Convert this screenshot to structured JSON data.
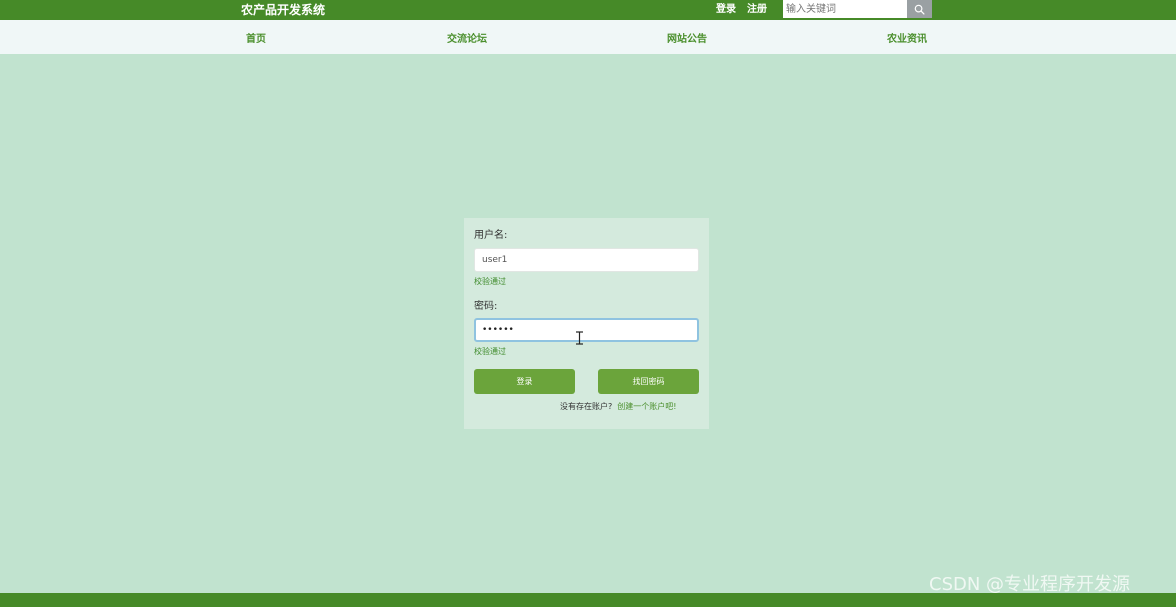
{
  "header": {
    "site_title": "农产品开发系统",
    "login_link": "登录",
    "register_link": "注册",
    "search_placeholder": "输入关键词",
    "search_icon": "magnifier-icon"
  },
  "nav": {
    "items": [
      {
        "label": "首页"
      },
      {
        "label": "交流论坛"
      },
      {
        "label": "网站公告"
      },
      {
        "label": "农业资讯"
      }
    ]
  },
  "login_form": {
    "username_label": "用户名:",
    "username_value": "user1",
    "username_validation": "校验通过",
    "password_label": "密码:",
    "password_value": "••••••",
    "password_validation": "校验通过",
    "login_button": "登录",
    "recover_button": "找回密码",
    "signup_prompt": "没有存在账户?",
    "signup_link": "创建一个账户吧!"
  },
  "watermark": "CSDN @专业程序开发源",
  "colors": {
    "brand_green": "#468a28",
    "page_background": "#c1e3cf",
    "button_green": "#6ba43b",
    "nav_text": "#4a8f2c"
  }
}
